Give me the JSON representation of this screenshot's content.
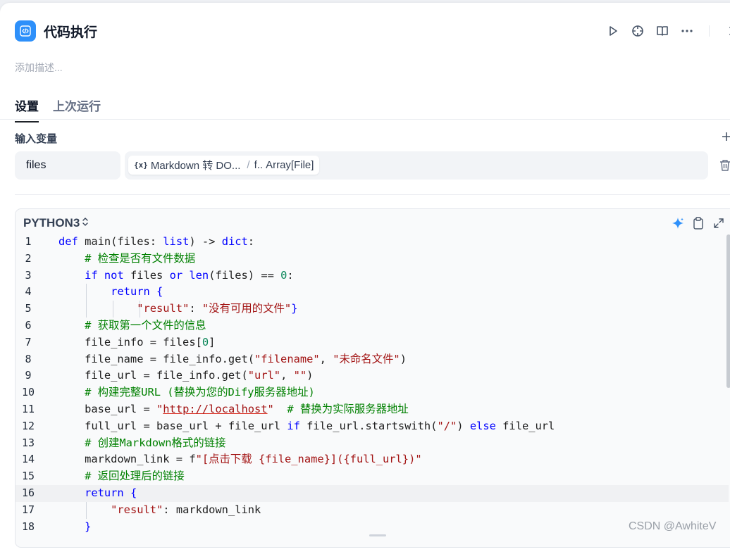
{
  "header": {
    "title": "代码执行",
    "icon": "code-icon",
    "actions": [
      "play-icon",
      "crosshair-icon",
      "book-icon",
      "more-icon",
      "close-icon"
    ]
  },
  "description_placeholder": "添加描述...",
  "tabs": [
    {
      "label": "设置",
      "active": true
    },
    {
      "label": "上次运行",
      "active": false
    }
  ],
  "input_vars": {
    "label": "输入变量",
    "add_icon": "plus-icon",
    "items": [
      {
        "name": "files",
        "source_node": "Markdown 转 DO...",
        "var_name": "f..",
        "type": "Array[File]"
      }
    ],
    "delete_icon": "trash-icon"
  },
  "code": {
    "language": "PYTHON3",
    "tools": [
      "sparkle-icon",
      "copy-icon",
      "expand-icon"
    ],
    "active_line": 16,
    "lines": [
      "def main(files: list) -> dict:",
      "    # 检查是否有文件数据",
      "    if not files or len(files) == 0:",
      "        return {",
      "            \"result\": \"没有可用的文件\"}",
      "    # 获取第一个文件的信息",
      "    file_info = files[0]",
      "    file_name = file_info.get(\"filename\", \"未命名文件\")",
      "    file_url = file_info.get(\"url\", \"\")",
      "    # 构建完整URL (替换为您的Dify服务器地址)",
      "    base_url = \"http://localhost\"  # 替换为实际服务器地址",
      "    full_url = base_url + file_url if file_url.startswith(\"/\") else file_url",
      "    # 创建Markdown格式的链接",
      "    markdown_link = f\"[点击下载 {file_name}]({full_url})\"",
      "    # 返回处理后的链接",
      "    return {",
      "        \"result\": markdown_link",
      "    }"
    ]
  },
  "watermark": "CSDN @AwhiteV",
  "colors": {
    "accent": "#2e90fa",
    "keyword": "#0000ff",
    "string": "#a31515",
    "comment": "#008000",
    "number": "#098658"
  }
}
